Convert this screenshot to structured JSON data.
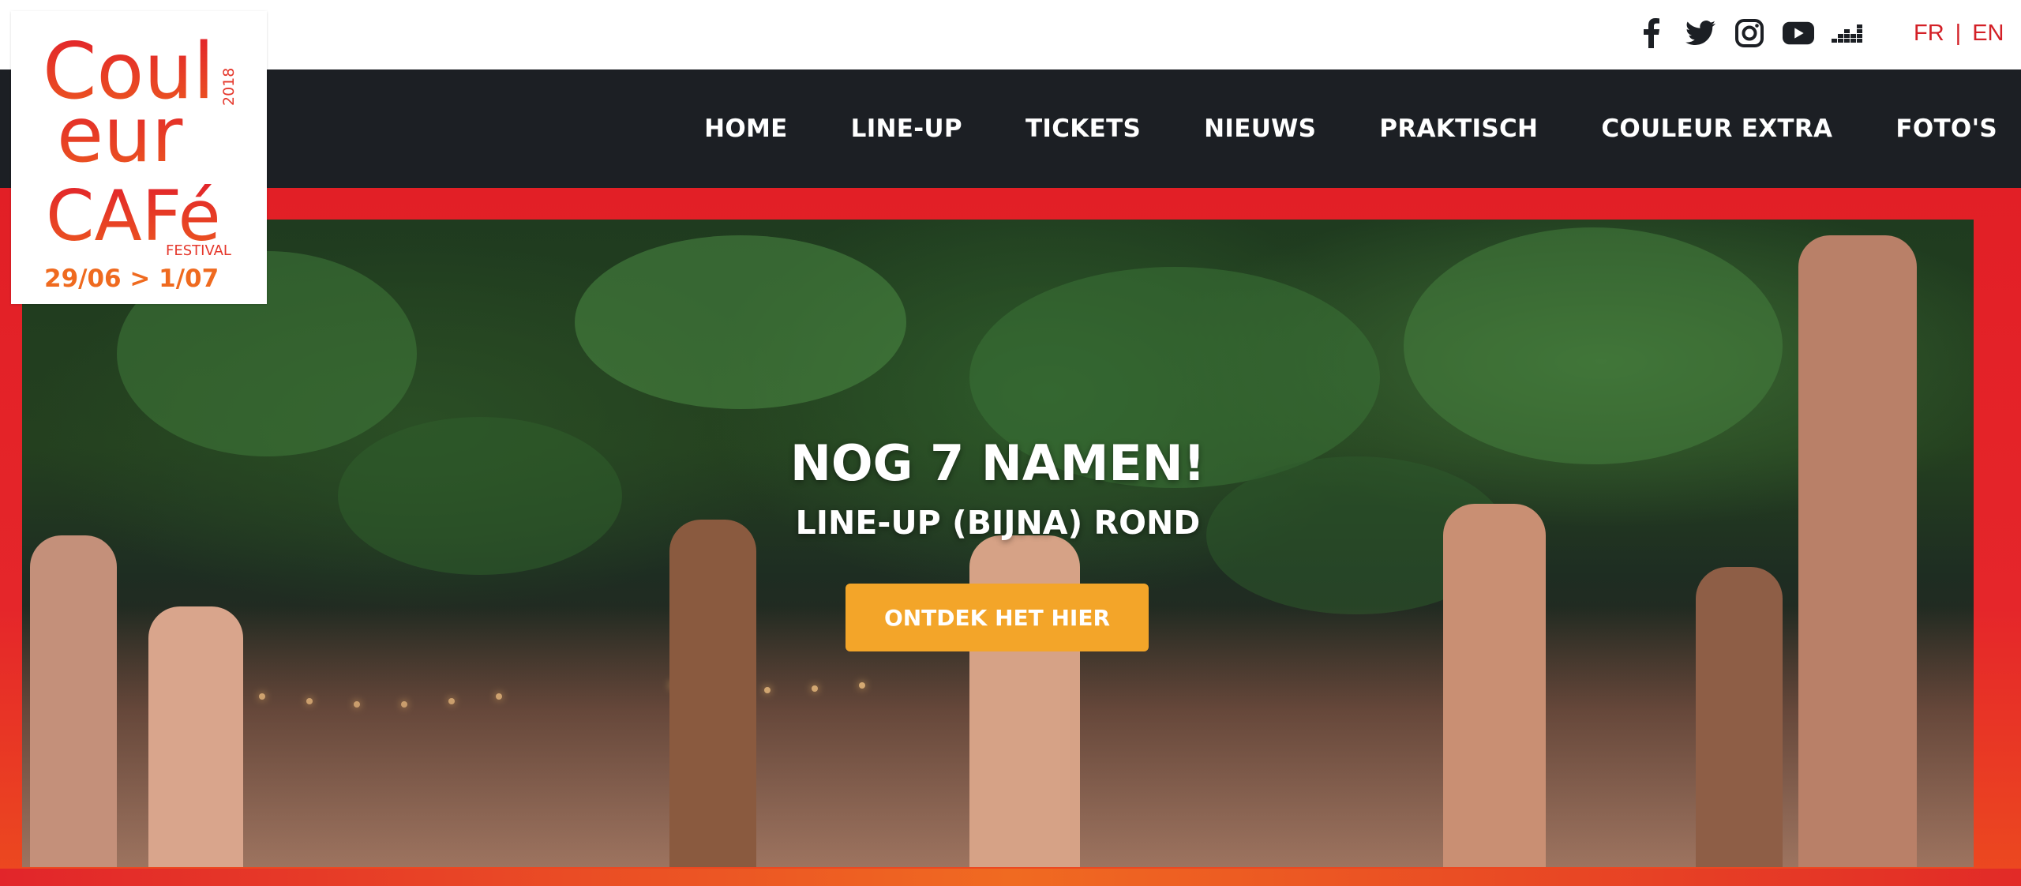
{
  "brand": {
    "logo_lines": [
      "Coul",
      "eur",
      "CAFé"
    ],
    "logo_year": "2018",
    "logo_festival": "FESTIVAL",
    "logo_dates": "29/06 > 1/07",
    "colors": {
      "red": "#e21f26",
      "orange": "#f3a529",
      "nav": "#1c1f24"
    }
  },
  "social": {
    "icons": [
      "facebook-icon",
      "twitter-icon",
      "instagram-icon",
      "youtube-icon",
      "deezer-icon"
    ]
  },
  "language": {
    "fr": "FR",
    "separator": "|",
    "en": "EN"
  },
  "nav": {
    "items": [
      {
        "label": "HOME"
      },
      {
        "label": "LINE-UP"
      },
      {
        "label": "TICKETS"
      },
      {
        "label": "NIEUWS"
      },
      {
        "label": "PRAKTISCH"
      },
      {
        "label": "COULEUR EXTRA"
      },
      {
        "label": "FOTO'S"
      }
    ]
  },
  "hero": {
    "headline": "NOG 7 NAMEN!",
    "subline": "LINE-UP (BIJNA) ROND",
    "cta_label": "ONTDEK HET HIER"
  }
}
